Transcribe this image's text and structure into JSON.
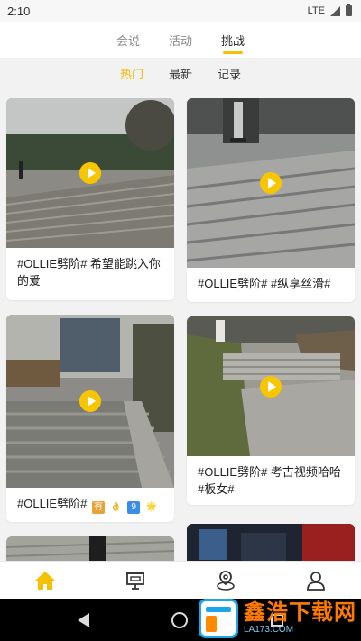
{
  "status_bar": {
    "time": "2:10",
    "network": "LTE"
  },
  "top_tabs": [
    {
      "label": "会说",
      "active": false
    },
    {
      "label": "活动",
      "active": false
    },
    {
      "label": "挑战",
      "active": true
    }
  ],
  "sub_tabs": [
    {
      "label": "热门",
      "active": true
    },
    {
      "label": "最新",
      "active": false
    },
    {
      "label": "记录",
      "active": false
    }
  ],
  "feed": {
    "cards": [
      {
        "caption": "#OLLIE劈阶# 希望能跳入你的爱"
      },
      {
        "caption": "#OLLIE劈阶# #纵享丝滑#"
      },
      {
        "caption": "#OLLIE劈阶#",
        "emojis": [
          "有",
          "👌",
          "9",
          "🌟"
        ]
      },
      {
        "caption": "#OLLIE劈阶# 考古视频哈哈#板女#"
      }
    ]
  },
  "bottom_nav": [
    {
      "name": "home-icon",
      "active": true
    },
    {
      "name": "presentation-icon",
      "active": false
    },
    {
      "name": "location-icon",
      "active": false
    },
    {
      "name": "profile-icon",
      "active": false
    }
  ],
  "colors": {
    "accent": "#f5c000",
    "background": "#f2f2f2"
  },
  "watermark": {
    "title": "鑫浩下载网",
    "subtitle": "LA173.COM"
  }
}
